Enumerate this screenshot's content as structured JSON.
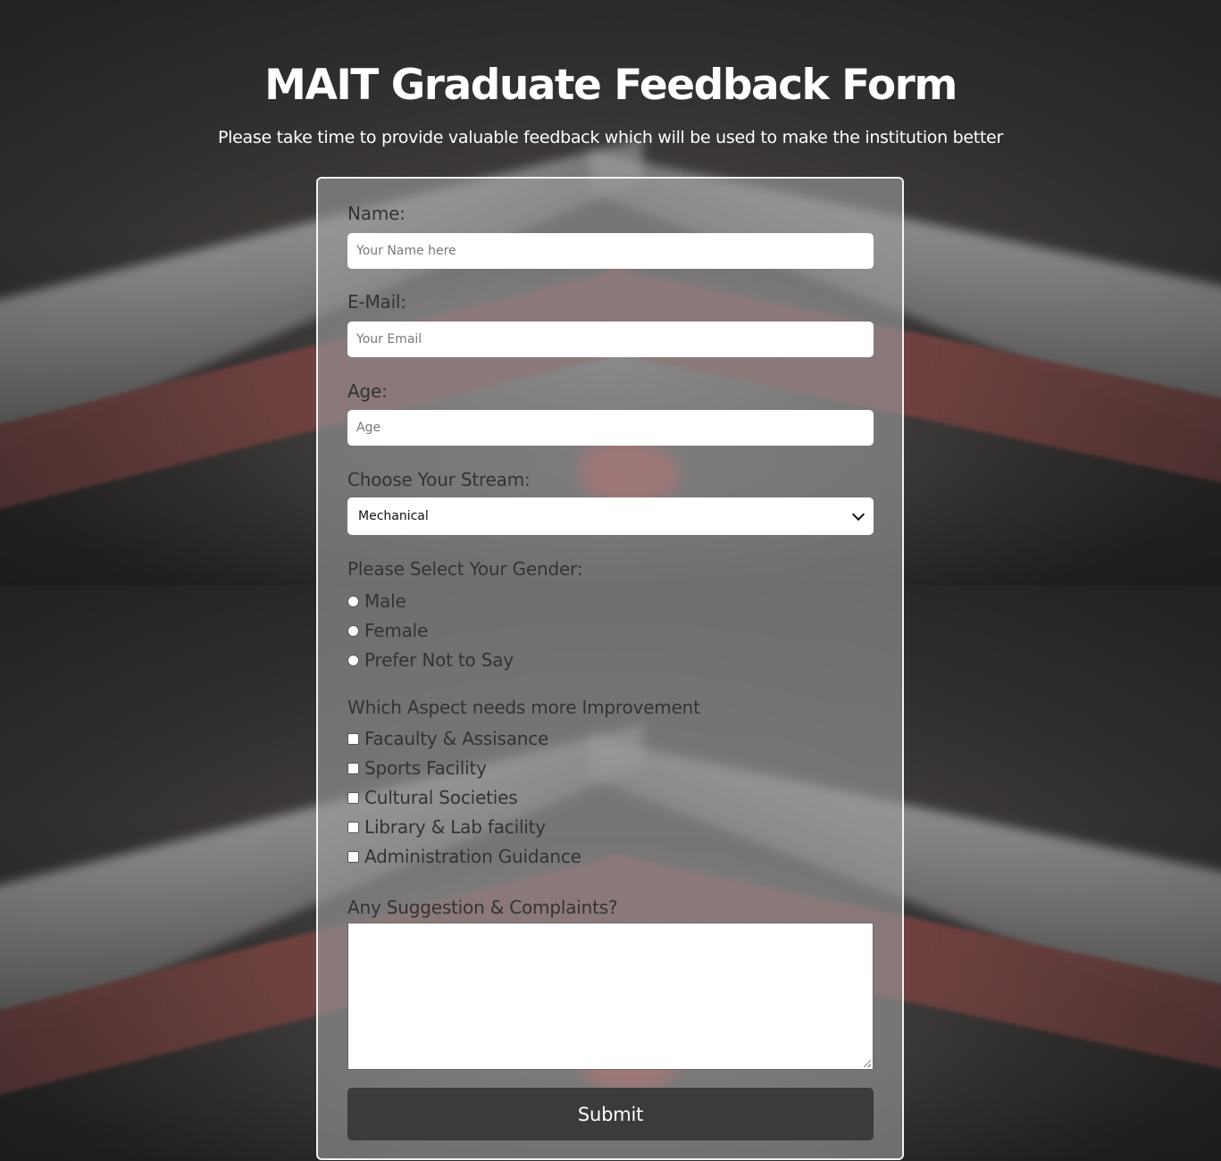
{
  "header": {
    "title": "MAIT Graduate Feedback Form",
    "subtitle": "Please take time to provide valuable feedback which will be used to make the institution better"
  },
  "form": {
    "name": {
      "label": "Name:",
      "placeholder": "Your Name here",
      "value": ""
    },
    "email": {
      "label": "E-Mail:",
      "placeholder": "Your Email",
      "value": ""
    },
    "age": {
      "label": "Age:",
      "placeholder": "Age",
      "value": ""
    },
    "stream": {
      "label": "Choose Your Stream:",
      "selected": "Mechanical"
    },
    "gender": {
      "label": "Please Select Your Gender:",
      "options": [
        "Male",
        "Female",
        "Prefer Not to Say"
      ]
    },
    "improvement": {
      "label": "Which Aspect needs more Improvement",
      "options": [
        "Facaulty & Assisance",
        "Sports Facility",
        "Cultural Societies",
        "Library & Lab facility",
        "Administration Guidance"
      ]
    },
    "suggestions": {
      "label": "Any Suggestion & Complaints?",
      "value": ""
    },
    "submit_label": "Submit"
  },
  "colors": {
    "panel_border": "#ffffff",
    "button_bg": "#3b3b3b",
    "button_text": "#ffffff"
  }
}
